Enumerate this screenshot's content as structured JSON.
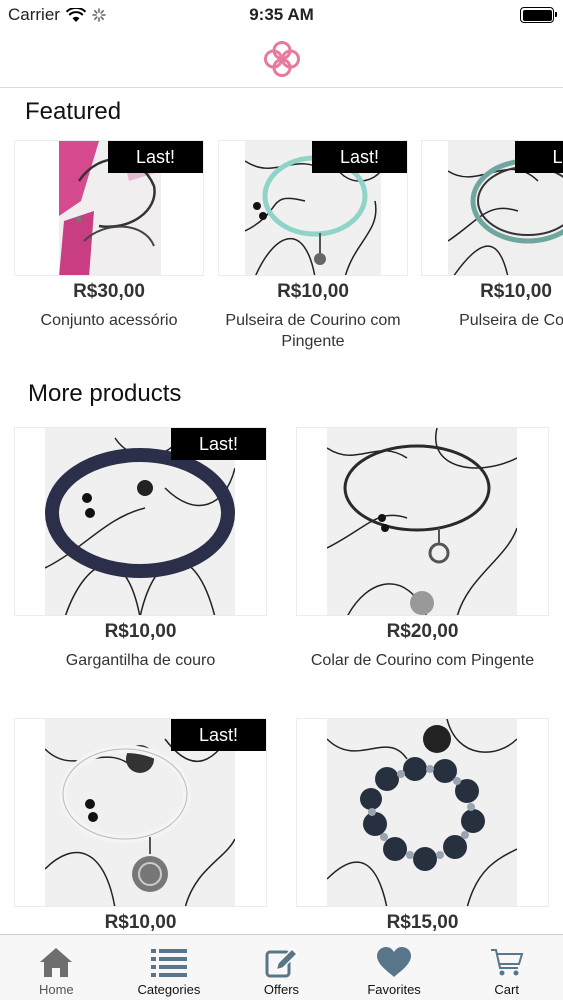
{
  "status_bar": {
    "carrier": "Carrier",
    "time": "9:35 AM",
    "battery_level": 1.0
  },
  "header": {
    "logo": "flower-logo-icon",
    "accent_color": "#e8799f"
  },
  "featured": {
    "title": "Featured",
    "items": [
      {
        "badge": "Last!",
        "price": "R$30,00",
        "name": "Conjunto acessório"
      },
      {
        "badge": "Last!",
        "price": "R$10,00",
        "name": "Pulseira de Courino com Pingente"
      },
      {
        "badge": "La",
        "price": "R$10,00",
        "name": "Pulseira de Cou"
      }
    ]
  },
  "more_products": {
    "title": "More products",
    "items": [
      {
        "badge": "Last!",
        "price": "R$10,00",
        "name": "Gargantilha de couro"
      },
      {
        "badge": "",
        "price": "R$20,00",
        "name": "Colar de Courino com Pingente"
      },
      {
        "badge": "Last!",
        "price": "R$10,00",
        "name": ""
      },
      {
        "badge": "",
        "price": "R$15,00",
        "name": ""
      }
    ]
  },
  "tabs": [
    {
      "label": "Home",
      "icon": "house-icon",
      "active": true
    },
    {
      "label": "Categories",
      "icon": "list-icon",
      "active": false
    },
    {
      "label": "Offers",
      "icon": "pencil-icon",
      "active": false
    },
    {
      "label": "Favorites",
      "icon": "heart-icon",
      "active": false
    },
    {
      "label": "Cart",
      "icon": "cart-icon",
      "active": false
    }
  ],
  "colors": {
    "tab_icon": "#58758a",
    "tab_icon_active": "#6e6e6e",
    "badge_bg": "#000000"
  }
}
